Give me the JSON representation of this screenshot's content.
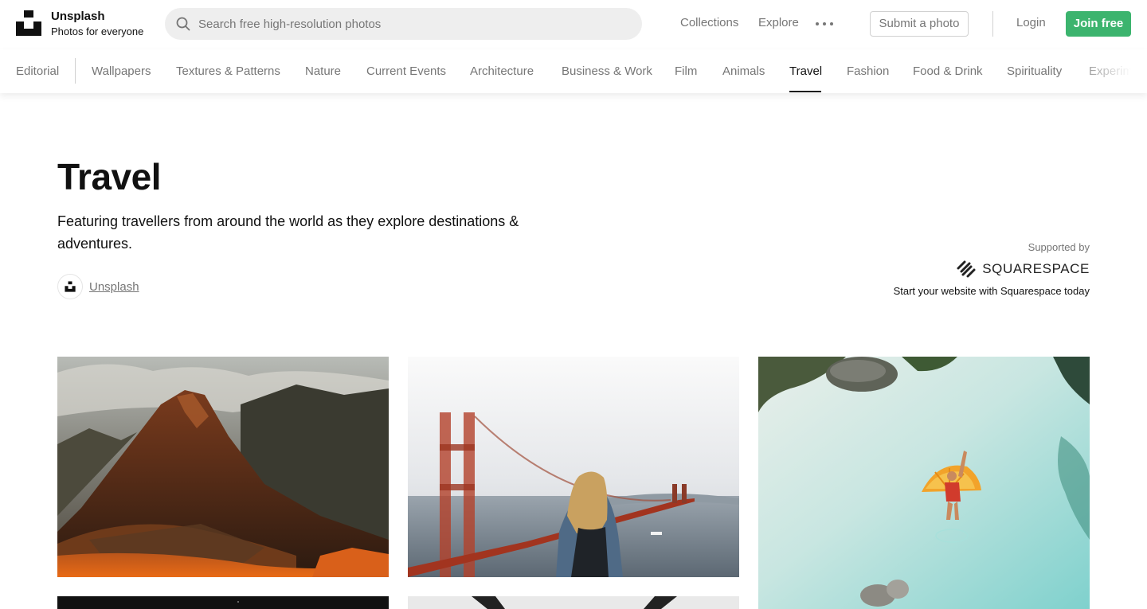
{
  "brand": {
    "name": "Unsplash",
    "tagline": "Photos for everyone"
  },
  "search": {
    "placeholder": "Search free high-resolution photos",
    "value": ""
  },
  "nav": {
    "collections": "Collections",
    "explore": "Explore",
    "more_icon": "ellipsis-icon",
    "submit": "Submit a photo",
    "login": "Login",
    "join": "Join free"
  },
  "categories": [
    "Editorial",
    "Wallpapers",
    "Textures & Patterns",
    "Nature",
    "Current Events",
    "Architecture",
    "Business & Work",
    "Film",
    "Animals",
    "Travel",
    "Fashion",
    "Food & Drink",
    "Spirituality",
    "Experime"
  ],
  "active_category": "Travel",
  "topic": {
    "title": "Travel",
    "description": "Featuring travellers from around the world as they explore destinations & adventures.",
    "curator": "Unsplash"
  },
  "sponsor": {
    "label": "Supported by",
    "name": "SQUARESPACE",
    "cta": "Start your website with Squarespace today"
  },
  "photos": [
    {
      "subject": "mountain-ruins-photo"
    },
    {
      "subject": "golden-gate-bridge-photo"
    },
    {
      "subject": "beach-float-aerial-photo"
    },
    {
      "subject": "dark-night-photo"
    },
    {
      "subject": "bright-arch-photo"
    }
  ],
  "colors": {
    "accent": "#3cb46e",
    "text": "#111111",
    "muted": "#767676",
    "border": "#d1d1d1"
  }
}
